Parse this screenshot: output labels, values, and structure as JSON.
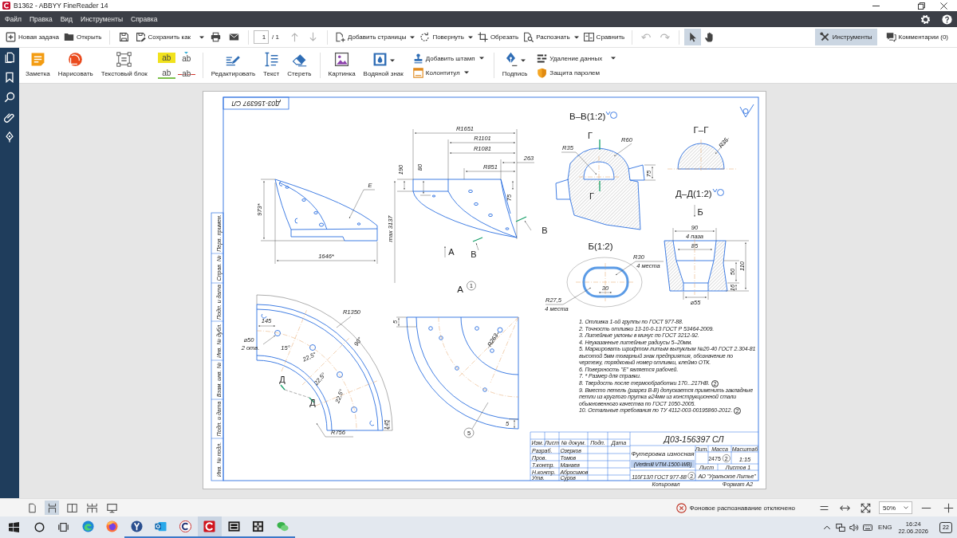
{
  "window": {
    "title": "B1362 - ABBYY FineReader 14"
  },
  "menu": {
    "items": [
      "Файл",
      "Правка",
      "Вид",
      "Инструменты",
      "Справка"
    ]
  },
  "toolbar": {
    "file_actions": [
      {
        "kind": "new_task",
        "label": "Новая задача",
        "dropdown": false
      },
      {
        "kind": "open",
        "label": "Открыть",
        "dropdown": false
      }
    ],
    "save_as": {
      "label": "Сохранить как",
      "dropdown": true
    },
    "page": {
      "value": "1",
      "total": "/ 1"
    },
    "page_nav": [
      {
        "kind": "up",
        "disabled": true
      },
      {
        "kind": "down",
        "disabled": true
      }
    ],
    "page_actions": [
      {
        "kind": "add_pages",
        "label": "Добавить страницы",
        "dropdown": true
      },
      {
        "kind": "rotate",
        "label": "Повернуть",
        "dropdown": true
      },
      {
        "kind": "crop",
        "label": "Обрезать",
        "dropdown": false
      },
      {
        "kind": "recognize",
        "label": "Распознать",
        "dropdown": true
      },
      {
        "kind": "compare",
        "label": "Сравнить",
        "dropdown": false
      }
    ],
    "history": [
      {
        "kind": "undo",
        "disabled": true
      },
      {
        "kind": "redo",
        "disabled": true
      }
    ],
    "modes": [
      {
        "kind": "pointer",
        "selected": true
      },
      {
        "kind": "hand",
        "selected": false
      }
    ],
    "panes": [
      {
        "kind": "tools",
        "label": "Инструменты",
        "selected": true
      },
      {
        "kind": "comments",
        "label": "Комментарии (0)",
        "selected": false
      }
    ]
  },
  "ribbon": {
    "annotate": [
      {
        "kind": "note",
        "label": "Заметка"
      },
      {
        "kind": "draw",
        "label": "Нарисовать"
      },
      {
        "kind": "text_block",
        "label": "Текстовый блок"
      }
    ],
    "markup": [
      {
        "kind": "highlight",
        "label": "ab"
      },
      {
        "kind": "insert",
        "label": "ab"
      },
      {
        "kind": "underline",
        "label": "ab"
      },
      {
        "kind": "strikethrough",
        "label": "ab"
      }
    ],
    "edit": [
      {
        "kind": "edit",
        "label": "Редактировать"
      },
      {
        "kind": "text",
        "label": "Текст"
      },
      {
        "kind": "erase",
        "label": "Стереть"
      }
    ],
    "insert": [
      {
        "kind": "picture",
        "label": "Картинка",
        "dropdown": false
      },
      {
        "kind": "watermark",
        "label": "Водяной знак",
        "dropdown": true
      }
    ],
    "page_marks": [
      {
        "kind": "stamp",
        "label": "Добавить штамп",
        "dropdown": true
      },
      {
        "kind": "header_footer",
        "label": "Колонтитул",
        "dropdown": true
      }
    ],
    "sign": {
      "label": "Подпись",
      "dropdown": true
    },
    "protect": [
      {
        "kind": "redact",
        "label": "Удаление данных",
        "dropdown": true
      },
      {
        "kind": "password",
        "label": "Защита паролем",
        "dropdown": false
      }
    ]
  },
  "sheet": {
    "code_stamp": "Д03-156397 СЛ",
    "margin_labels": [
      "Перв. примен.",
      "Справ. №",
      "Подп. и дата",
      "Инв. № дубл.",
      "Взам. инв. №",
      "Подп. и дата",
      "Инв. № подл."
    ],
    "side_view": {
      "labels": [
        "973*",
        "1646*",
        "Е"
      ]
    },
    "front_view": {
      "labels": [
        "R1651",
        "R1101",
        "R1081",
        "R851",
        "263",
        "190",
        "80",
        "75",
        "max 3137"
      ],
      "section_marks": [
        "В",
        "В"
      ],
      "view_mark": "А"
    },
    "view_a": {
      "title": "А",
      "note_number": "1",
      "labels": [
        "5",
        "R263",
        "5"
      ],
      "position_number": "5"
    },
    "section_v": {
      "title": "В–В(1:2)",
      "section_marks": [
        "Г",
        "Г"
      ],
      "labels": [
        "R35",
        "R60",
        "75"
      ]
    },
    "section_g": {
      "title": "Г–Г",
      "labels": [
        "R35"
      ]
    },
    "section_d": {
      "title": "Д–Д(1:2)",
      "view_mark": "Б",
      "labels": [
        "90",
        "4 паза",
        "85",
        "110",
        "50",
        "16",
        "⌀55"
      ]
    },
    "detail_b": {
      "title": "Б(1:2)",
      "labels": [
        "R30",
        "4 места",
        "30",
        "R27,5",
        "4 места"
      ]
    },
    "plan_view": {
      "labels": [
        "R1350",
        "145",
        "⌀50",
        "2 отв.",
        "90°",
        "15°",
        "22,5°",
        "22,5°",
        "22,5°",
        "R756",
        "145"
      ],
      "section_marks": [
        "Д",
        "Д"
      ]
    },
    "notes": [
      {
        "text": "1. Отливка 1-ой группы по ГОСТ 977-88."
      },
      {
        "text": "2. Точность отливки 13-10-0-13 ГОСТ Р 53464-2009."
      },
      {
        "text": "3. Литейные уклоны в минус по ГОСТ 3212-92."
      },
      {
        "text": "4. Неуказанные литейные радиусы 5–20мм."
      },
      {
        "text": "5. Маркировать шрифтом литым выпуклым №20-40 ГОСТ 2.304-81 высотой 5мм товарный знак предприятия, обозначение по чертежу, порядковый номер отливки, клеймо ОТК."
      },
      {
        "text": "6. Поверхность \"Е\" является рабочей."
      },
      {
        "text": "7. * Размер для справки."
      },
      {
        "text": "8. Твердость после термообработки 170...217НВ.",
        "revision": "2"
      },
      {
        "text": "9. Вместо петель (разрез В-В) допускается применить закладные петли из круглого прутка ⌀24мм из конструкционной стали обыкновенного качества по ГОСТ 1050-2005."
      },
      {
        "text": "10. Остальные требования по ТУ 4112-003-00195860-2012.",
        "revision": "2"
      }
    ],
    "title_block": {
      "code": "Д03-156397 СЛ",
      "name": "Футеровка износная",
      "subtitle": {
        "text": "(Vertimill VTM-1500-WB)",
        "highlighted": true
      },
      "material": {
        "text": "110Г13Л ГОСТ 977-88",
        "revision": "2"
      },
      "company": "АО \"Уральское Литье\"",
      "headers": [
        "Лит.",
        "Масса",
        "Масштаб"
      ],
      "mass": {
        "text": "2475",
        "revision": "2"
      },
      "scale": "1:15",
      "sheet": "Лист",
      "sheets": "Листов 1",
      "columns": [
        "Изм.",
        "Лист",
        "№ докум.",
        "Подп.",
        "Дата"
      ],
      "roles": [
        {
          "role": "Разраб.",
          "name": "Озерков"
        },
        {
          "role": "Пров.",
          "name": "Томов"
        },
        {
          "role": "Т.контр.",
          "name": "Манаев"
        },
        {
          "role": "Н.контр.",
          "name": "Абросимов"
        },
        {
          "role": "Утв.",
          "name": "Суров"
        }
      ],
      "copied": "Копировал",
      "format": "Формат А2"
    }
  },
  "status_bar": {
    "view_modes": [
      {
        "kind": "single",
        "selected": false
      },
      {
        "kind": "continuous",
        "selected": true
      },
      {
        "kind": "two_pages",
        "selected": false
      },
      {
        "kind": "two_continuous",
        "selected": false
      },
      {
        "kind": "fullscreen",
        "selected": false
      }
    ],
    "recognition": "Фоновое распознавание отключено",
    "zoom": "50%"
  },
  "taskbar": {
    "apps": [
      {
        "kind": "edge",
        "running": false,
        "active": false
      },
      {
        "kind": "firefox",
        "running": false,
        "active": false
      },
      {
        "kind": "yandex",
        "running": true,
        "active": false
      },
      {
        "kind": "outlook",
        "running": true,
        "active": false
      },
      {
        "kind": "c_app",
        "running": true,
        "active": false
      },
      {
        "kind": "abbyy",
        "running": true,
        "active": true
      },
      {
        "kind": "archiver",
        "running": true,
        "active": false
      },
      {
        "kind": "puzzle",
        "running": true,
        "active": false
      },
      {
        "kind": "chat",
        "running": true,
        "active": false
      }
    ],
    "language": "ENG",
    "time": "16:24",
    "date": "22.06.2026",
    "notifications": "22"
  }
}
